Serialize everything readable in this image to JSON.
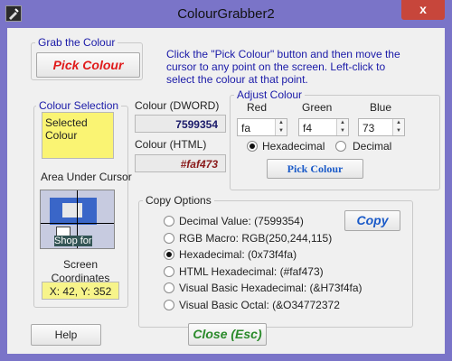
{
  "window": {
    "title": "ColourGrabber2",
    "close_glyph": "x"
  },
  "grab": {
    "legend": "Grab the Colour",
    "pick_button": "Pick Colour",
    "instructions": "Click the \"Pick Colour\" button and then move the cursor to any point on the screen. Left-click to select the colour at that point."
  },
  "selection": {
    "legend": "Colour Selection",
    "selected_label": "Selected Colour",
    "swatch_color": "#faf473",
    "area_label": "Area Under Cursor",
    "preview_text": "Shop for",
    "coords_label": "Screen\nCoordinates",
    "coords_value": "X: 42, Y: 352"
  },
  "dword": {
    "label": "Colour (DWORD)",
    "value": "7599354"
  },
  "html_colour": {
    "label": "Colour (HTML)",
    "value": "#faf473"
  },
  "adjust": {
    "legend": "Adjust Colour",
    "red_label": "Red",
    "green_label": "Green",
    "blue_label": "Blue",
    "red_value": "fa",
    "green_value": "f4",
    "blue_value": "73",
    "hex_label": "Hexadecimal",
    "dec_label": "Decimal",
    "hex_selected": true,
    "pick_button": "Pick Colour"
  },
  "copy": {
    "legend": "Copy Options",
    "copy_button": "Copy",
    "selected_index": 2,
    "options": [
      "Decimal Value: (7599354)",
      "RGB Macro: RGB(250,244,115)",
      "Hexadecimal: (0x73f4fa)",
      "HTML Hexadecimal: (#faf473)",
      "Visual Basic Hexadecimal: (&H73f4fa)",
      "Visual Basic Octal: (&O34772372"
    ]
  },
  "footer": {
    "help": "Help",
    "close": "Close (Esc)"
  },
  "colors": {
    "frame": "#7a74c8",
    "accent_red": "#e01a1a",
    "accent_blue": "#1a1aa8",
    "accent_green": "#2a8a2a",
    "highlight_yellow": "#f7f48a",
    "close_red": "#c7463b"
  }
}
